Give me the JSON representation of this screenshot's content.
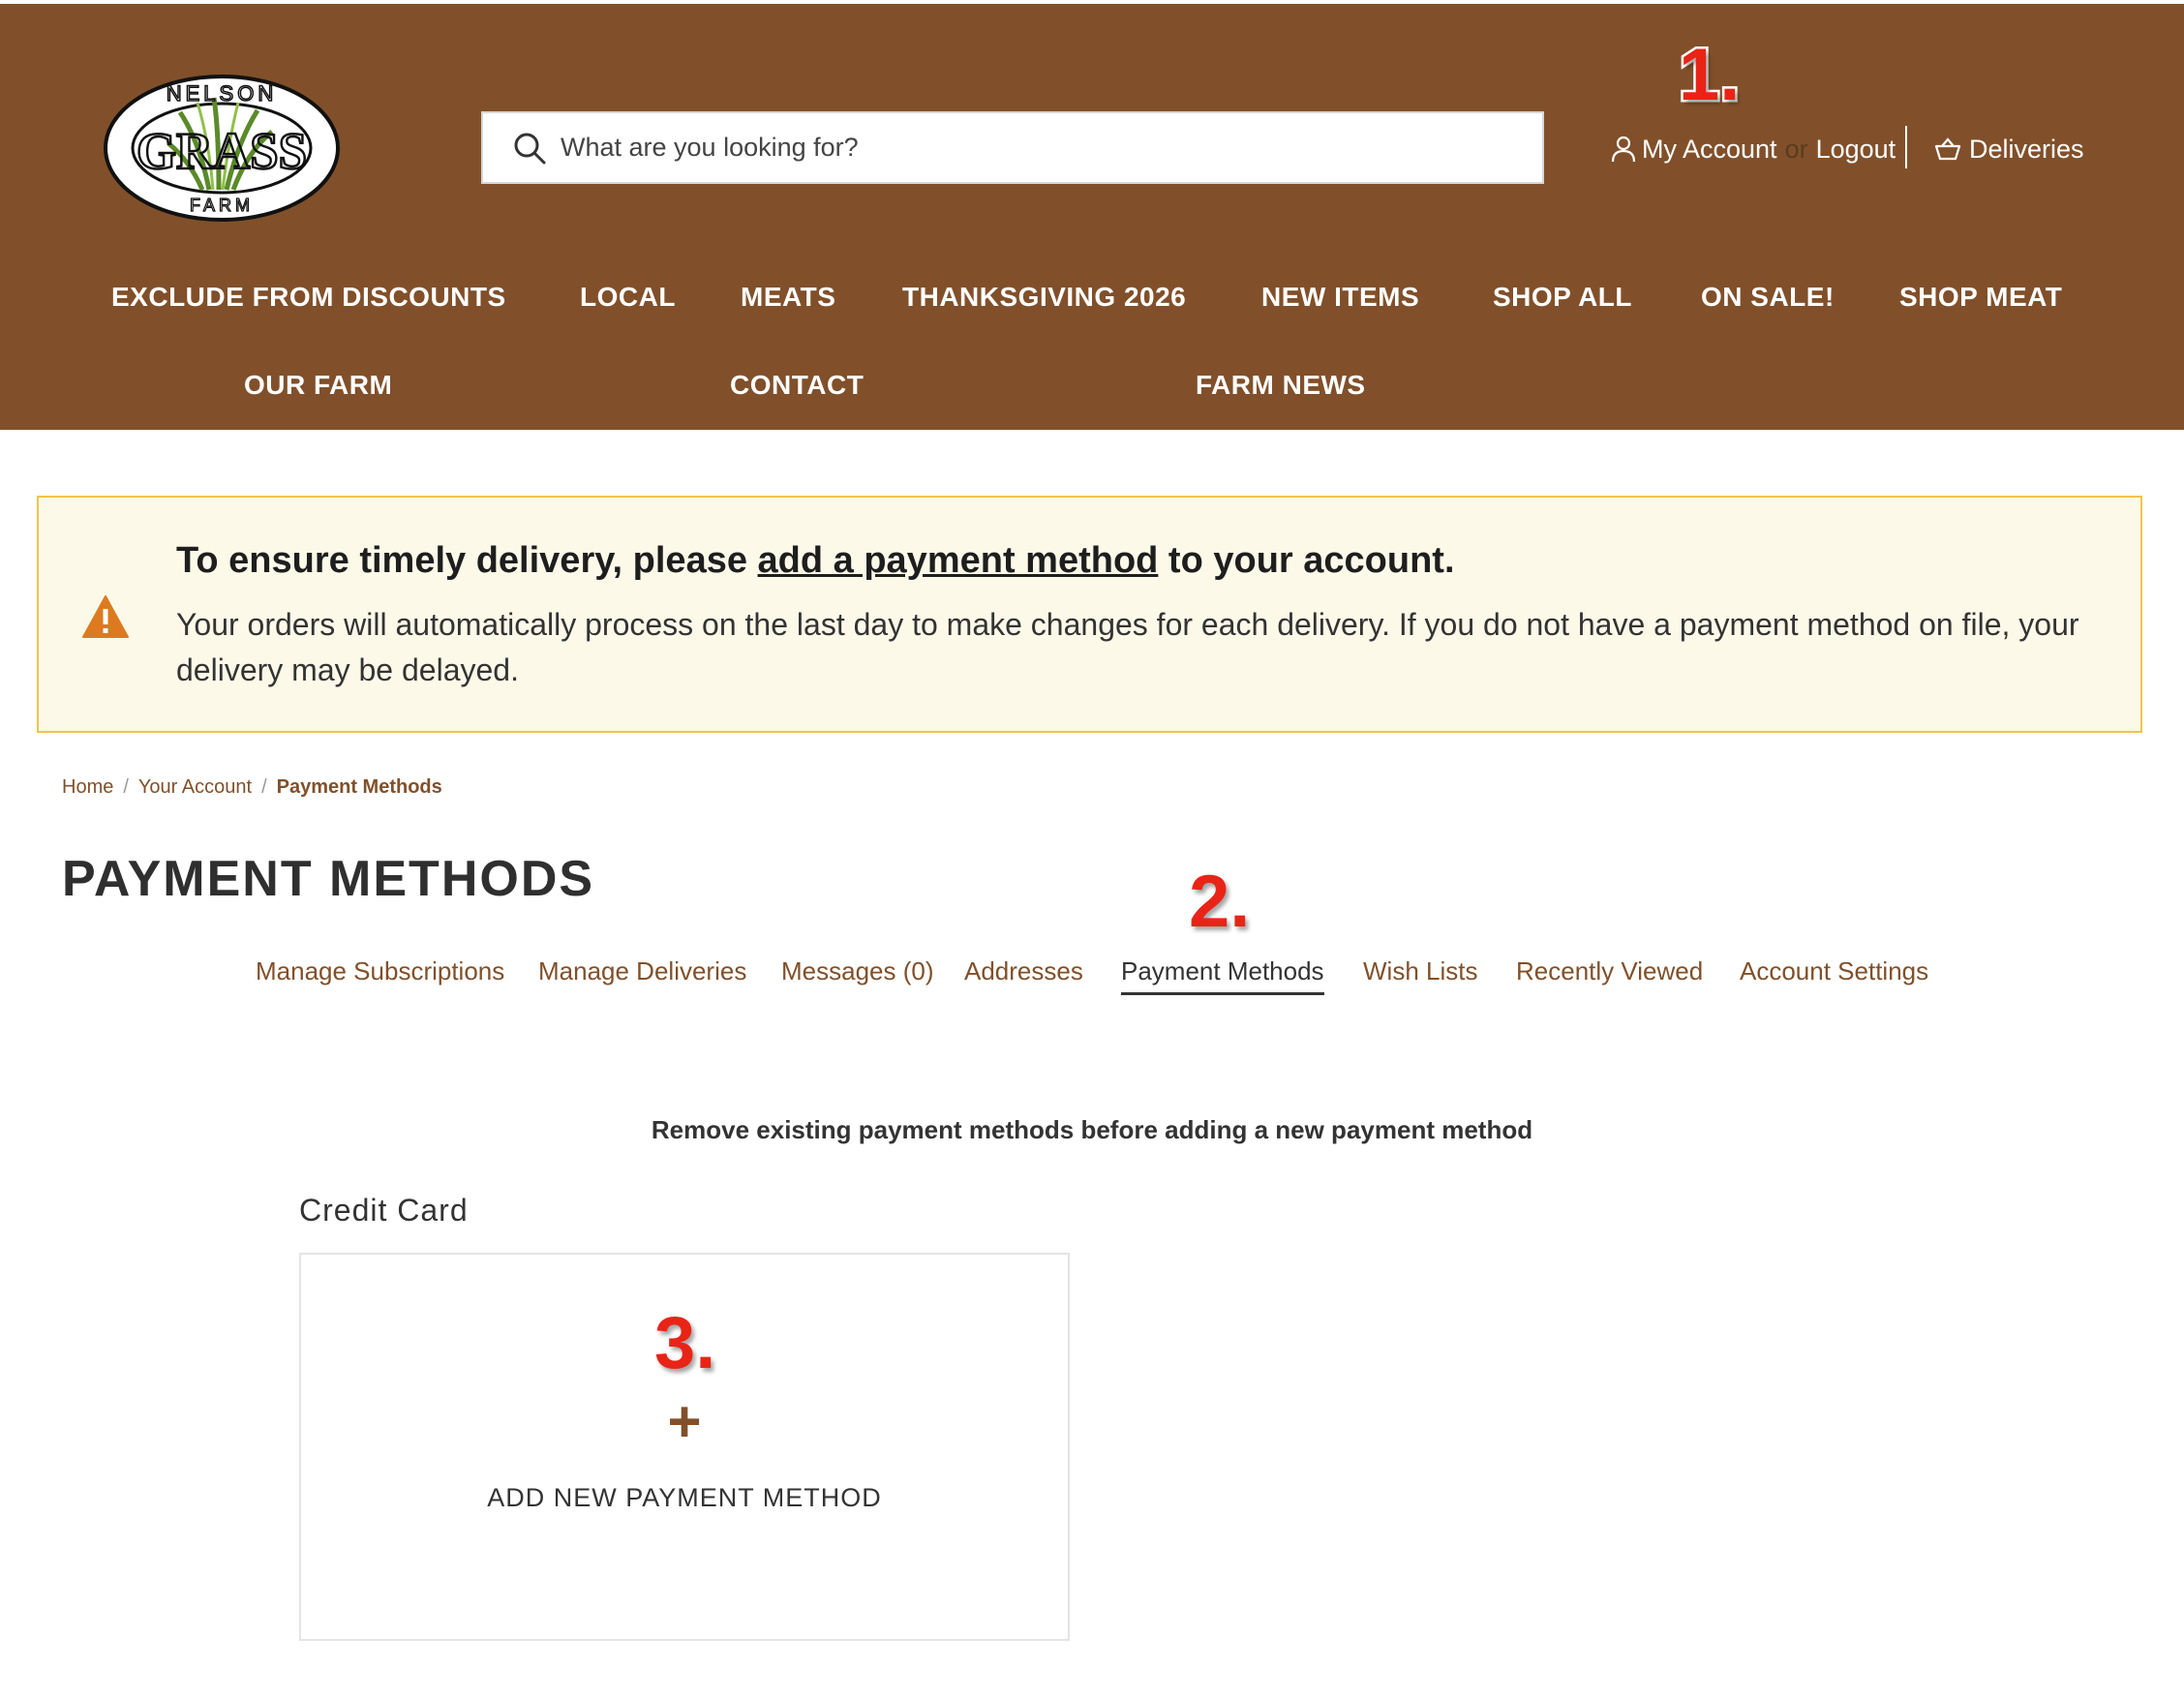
{
  "logo": {
    "top_text": "NELSON",
    "main_text": "GRASS",
    "bottom_text": "FARM"
  },
  "search": {
    "placeholder": "What are you looking for?",
    "icon": "search-icon"
  },
  "account": {
    "my_account": "My Account",
    "or": "or",
    "logout": "Logout",
    "deliveries": "Deliveries"
  },
  "nav": {
    "row1": [
      "EXCLUDE FROM DISCOUNTS",
      "LOCAL",
      "MEATS",
      "THANKSGIVING 2026",
      "NEW ITEMS",
      "SHOP ALL",
      "ON SALE!",
      "SHOP MEAT"
    ],
    "row2": [
      "OUR FARM",
      "CONTACT",
      "FARM NEWS"
    ]
  },
  "alert": {
    "title_before": "To ensure timely delivery, please ",
    "title_link": "add a payment method",
    "title_after": " to your account.",
    "body": "Your orders will automatically process on the last day to make changes for each delivery. If you do not have a payment method on file, your delivery may be delayed."
  },
  "breadcrumb": {
    "home": "Home",
    "account": "Your Account",
    "current": "Payment Methods"
  },
  "page_title": "PAYMENT METHODS",
  "tabs": [
    "Manage Subscriptions",
    "Manage Deliveries",
    "Messages (0)",
    "Addresses",
    "Payment Methods",
    "Wish Lists",
    "Recently Viewed",
    "Account Settings"
  ],
  "note": "Remove existing payment methods before adding a new payment method",
  "section": {
    "label": "Credit Card",
    "add_plus": "+",
    "add_label": "ADD NEW PAYMENT METHOD"
  },
  "steps": [
    "1.",
    "2.",
    "3."
  ],
  "colors": {
    "header": "#81502a",
    "accent": "#81502a",
    "alert_bg": "#fdf9e9",
    "alert_border": "#efc54a",
    "step": "#e92417"
  }
}
